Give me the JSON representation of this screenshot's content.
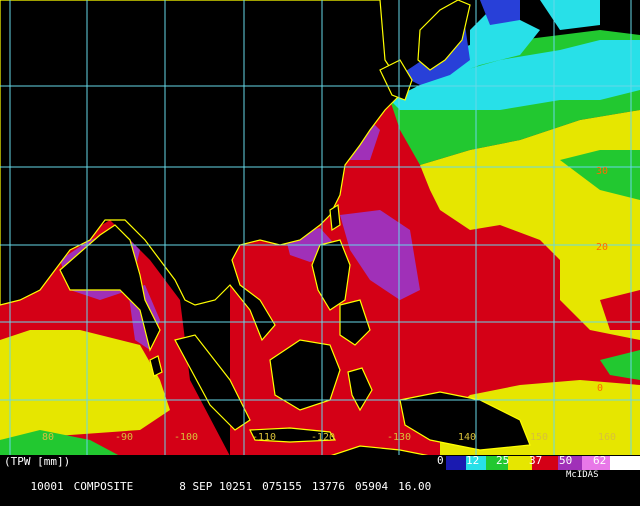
{
  "map": {
    "product": "(TPW [mm])",
    "composite_id": "10001",
    "composite_label": "COMPOSITE",
    "date": "8 SEP 10251",
    "time": "075155",
    "num1": "13776",
    "num2": "05904",
    "num3": "16.00",
    "logo": "McIDAS",
    "lon_labels": [
      "80",
      "-90",
      "-100",
      "-110",
      "-120",
      "-130",
      "140",
      "150",
      "160"
    ],
    "lat_labels": [
      "30",
      "20",
      "0"
    ],
    "legend_labels": [
      "0",
      "12",
      "25",
      "37",
      "50",
      "62",
      "75"
    ],
    "colors": {
      "background": "#000000",
      "grid": "#66d9e8",
      "coast": "#ffff00",
      "red": "#d40016",
      "magenta": "#a030b8",
      "yellow": "#e6e600",
      "green": "#22c830",
      "cyan": "#28e0e8",
      "blue": "#2840d8",
      "label_lon": "#d8c03a",
      "label_lat": "#ff6a00"
    }
  }
}
